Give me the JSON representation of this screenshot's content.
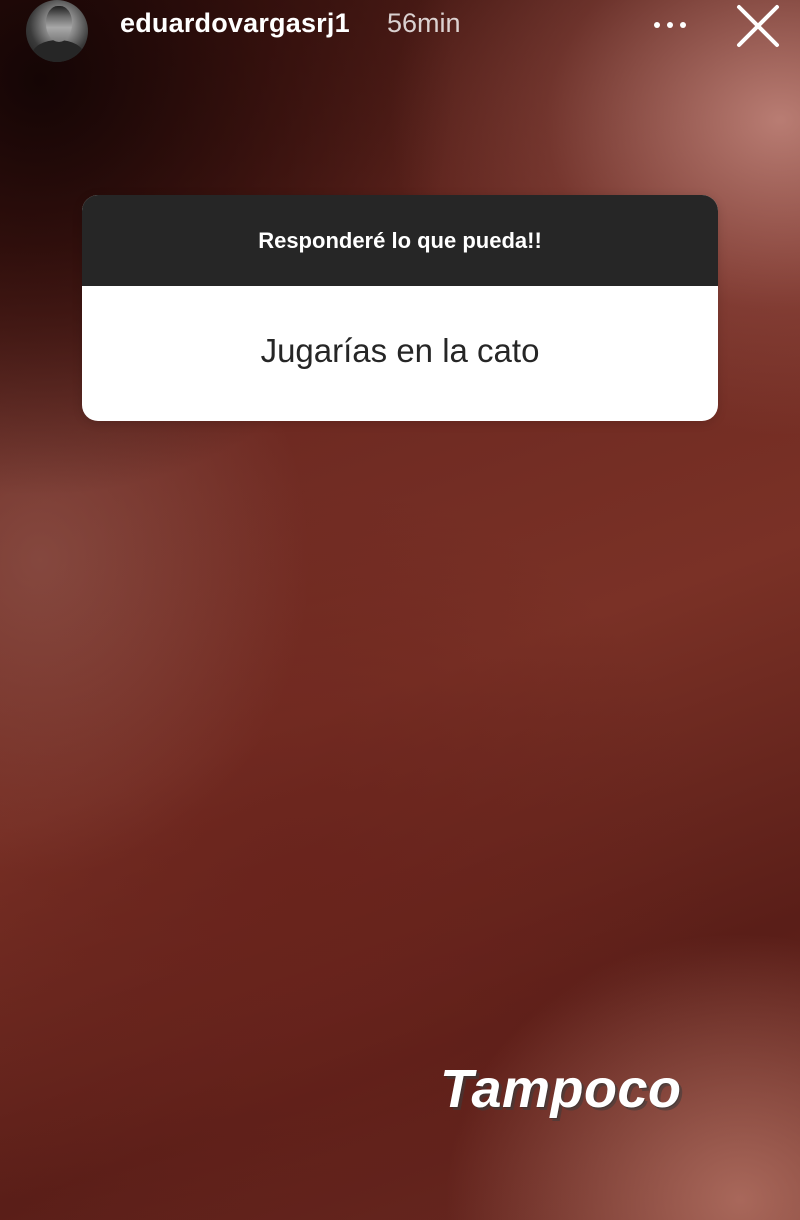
{
  "story": {
    "username": "eduardovargasrj1",
    "time_ago": "56min",
    "more_icon": "ellipsis-icon",
    "close_icon": "close-icon"
  },
  "question_sticker": {
    "prompt": "Responderé lo que pueda!!",
    "question": "Jugarías en la cato"
  },
  "answer": {
    "text": "Tampoco"
  },
  "colors": {
    "sticker_header": "#262626",
    "sticker_body": "#ffffff",
    "background_primary": "#6e2a22"
  }
}
